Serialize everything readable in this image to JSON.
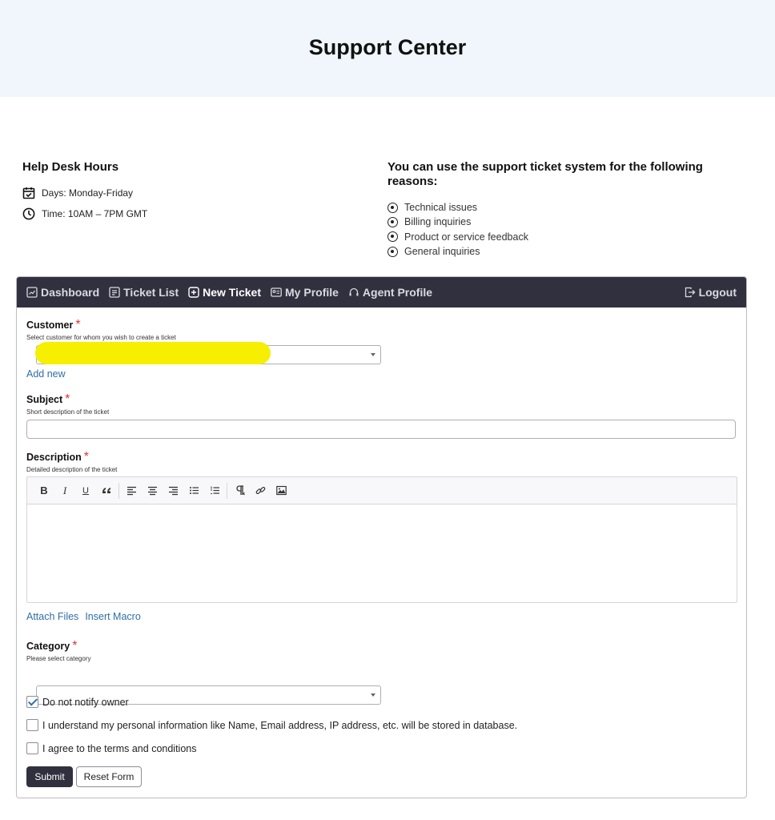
{
  "page_title": "Support Center",
  "help_desk": {
    "title": "Help Desk Hours",
    "days": "Days: Monday-Friday",
    "time": "Time: 10AM – 7PM GMT"
  },
  "reasons": {
    "title": "You can use the support ticket system for the following reasons:",
    "items": [
      "Technical issues",
      "Billing inquiries",
      "Product or service feedback",
      "General inquiries"
    ]
  },
  "nav": {
    "items": [
      {
        "label": "Dashboard",
        "icon": "dashboard-icon"
      },
      {
        "label": "Ticket List",
        "icon": "list-icon"
      },
      {
        "label": "New Ticket",
        "icon": "plus-square-icon",
        "active": true
      },
      {
        "label": "My Profile",
        "icon": "id-card-icon"
      },
      {
        "label": "Agent Profile",
        "icon": "headset-icon"
      }
    ],
    "logout": "Logout"
  },
  "form": {
    "customer": {
      "label": "Customer",
      "required_mark": "*",
      "help": "Select customer for whom you wish to create a ticket",
      "value": "",
      "add_new": "Add new"
    },
    "subject": {
      "label": "Subject",
      "required_mark": "*",
      "help": "Short description of the ticket",
      "value": ""
    },
    "description": {
      "label": "Description",
      "required_mark": "*",
      "help": "Detailed description of the ticket",
      "toolbar": [
        "B",
        "I",
        "U",
        "blockquote",
        "align-left",
        "align-center",
        "align-right",
        "bullet-list",
        "numbered-list",
        "paragraph-direction",
        "link",
        "image"
      ],
      "value": ""
    },
    "attach_files": "Attach Files",
    "insert_macro": "Insert Macro",
    "category": {
      "label": "Category",
      "required_mark": "*",
      "help": "Please select category",
      "value": ""
    },
    "checkboxes": [
      {
        "label": "Do not notify owner",
        "checked": true
      },
      {
        "label": "I understand my personal information like Name, Email address, IP address, etc. will be stored in database.",
        "checked": false
      },
      {
        "label": "I agree to the terms and conditions",
        "checked": false
      }
    ],
    "submit": "Submit",
    "reset": "Reset Form"
  },
  "colors": {
    "navbar": "#31303f",
    "link": "#2f6fa6",
    "required": "#d33333",
    "redaction": "#f7ef00",
    "hero_bg": "#f0f6fc"
  }
}
